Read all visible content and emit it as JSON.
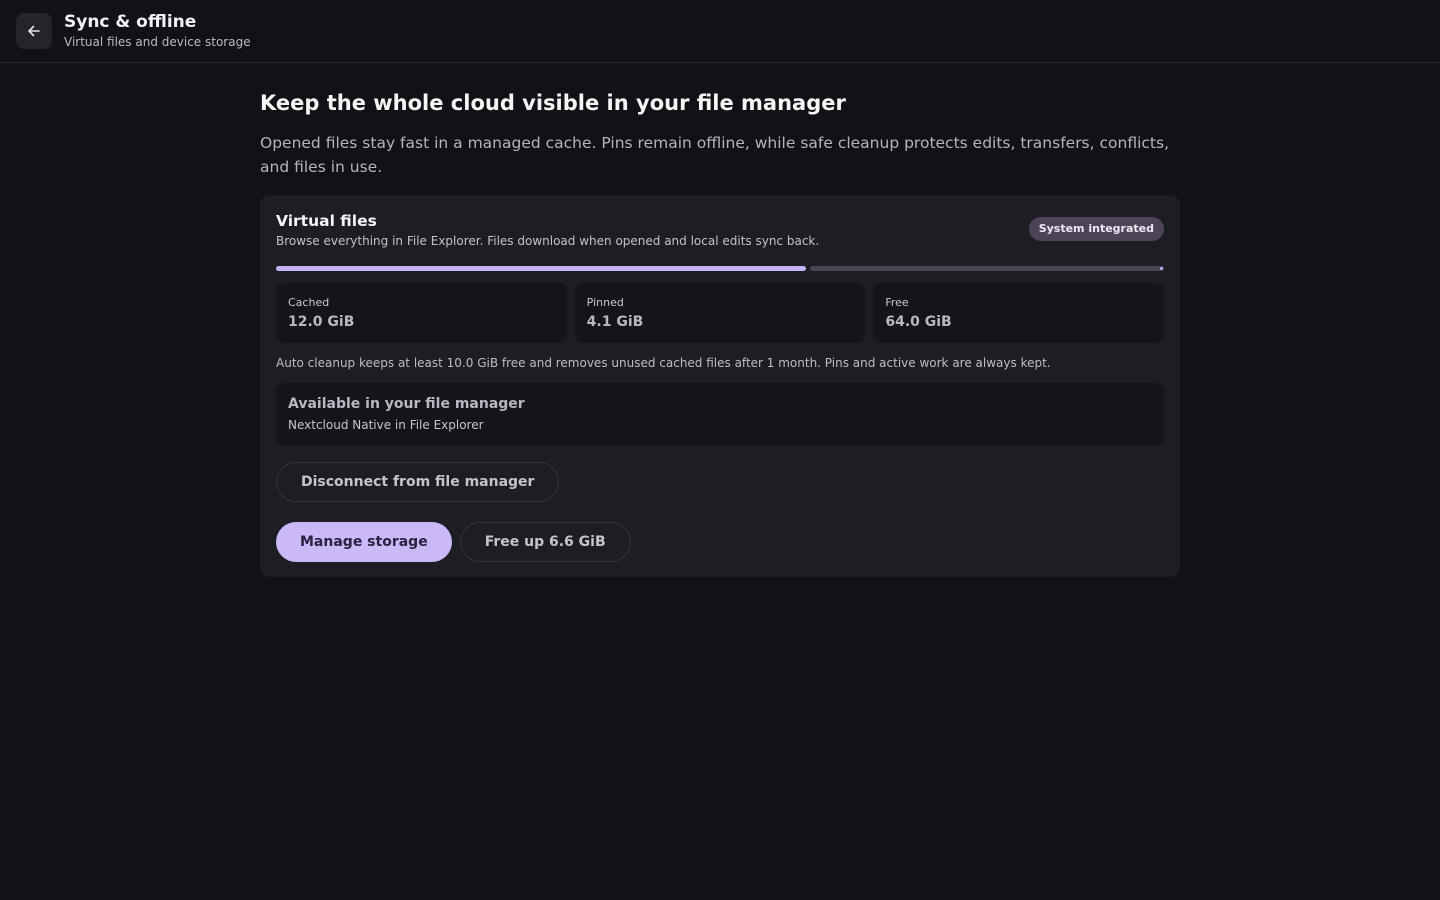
{
  "header": {
    "title": "Sync & offline",
    "subtitle": "Virtual files and device storage"
  },
  "main": {
    "title": "Keep the whole cloud visible in your file manager",
    "description": "Opened files stay fast in a managed cache. Pins remain offline, while safe cleanup protects edits, transfers, conflicts, and files in use."
  },
  "card": {
    "title": "Virtual files",
    "subtitle": "Browse everything in File Explorer. Files download when opened and local edits sync back.",
    "badge": "System integrated",
    "usage_bar": {
      "cached_fraction": 0.6,
      "pinned_fraction": 0.4
    },
    "stats": [
      {
        "label": "Cached",
        "value": "12.0 GiB"
      },
      {
        "label": "Pinned",
        "value": "4.1 GiB"
      },
      {
        "label": "Free",
        "value": "64.0 GiB"
      }
    ],
    "note": "Auto cleanup keeps at least 10.0 GiB free and removes unused cached files after 1 month. Pins and active work are always kept.",
    "availability": {
      "title": "Available in your file manager",
      "subtitle": "Nextcloud Native in File Explorer"
    },
    "buttons": {
      "disconnect": "Disconnect from file manager",
      "manage": "Manage storage",
      "free_up": "Free up 6.6 GiB"
    }
  },
  "colors": {
    "accent": "#cbb8f7",
    "background": "#111216",
    "card": "#1d1e23"
  },
  "icons": {
    "back": "arrow-left-icon"
  }
}
